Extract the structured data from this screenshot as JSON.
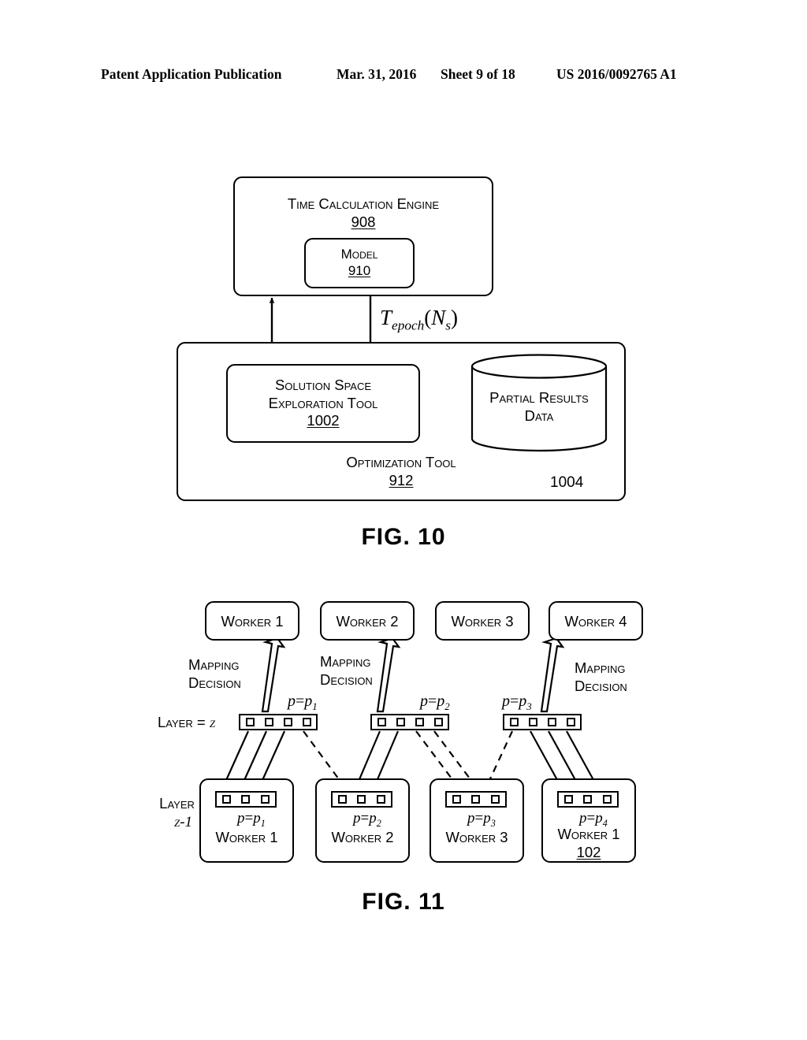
{
  "header": {
    "publication": "Patent Application Publication",
    "date": "Mar. 31, 2016",
    "sheet": "Sheet 9 of 18",
    "patent_number": "US 2016/0092765 A1"
  },
  "fig10": {
    "caption": "FIG. 10",
    "time_calculation_engine": {
      "label": "Time Calculation Engine",
      "ref": "908"
    },
    "model": {
      "label": "Model",
      "ref": "910"
    },
    "solution_space_exploration_tool": {
      "label_line1": "Solution Space",
      "label_line2": "Exploration Tool",
      "ref": "1002"
    },
    "partial_results_data": {
      "label_line1": "Partial Results",
      "label_line2": "Data",
      "ref": "1004"
    },
    "optimization_tool": {
      "label": "Optimization Tool",
      "ref": "912"
    },
    "epoch_arrow_label": {
      "base": "T",
      "sub": "epoch",
      "arg_open": "(",
      "arg": "N",
      "arg_sub": "s",
      "arg_close": ")"
    }
  },
  "fig11": {
    "caption": "FIG. 11",
    "top_workers": [
      {
        "label": "Worker 1",
        "has_mapping_arrow": true
      },
      {
        "label": "Worker 2",
        "has_mapping_arrow": true
      },
      {
        "label": "Worker 3",
        "has_mapping_arrow": false
      },
      {
        "label": "Worker 4",
        "has_mapping_arrow": true
      }
    ],
    "mapping_decision_labels": [
      {
        "line1": "Mapping",
        "line2": "Decision"
      },
      {
        "line1": "Mapping",
        "line2": "Decision"
      },
      {
        "line1": "Mapping",
        "line2": "Decision"
      }
    ],
    "layer_z_label": {
      "prefix": "Layer =",
      "value": "z"
    },
    "layer_z_minus_1_label": {
      "prefix": "Layer =",
      "value": "z-1"
    },
    "layer_z_groups": [
      {
        "p_label_base": "p",
        "p_label_eq": "=",
        "p_label_var": "p",
        "p_label_sub": "1",
        "cells": 4
      },
      {
        "p_label_base": "p",
        "p_label_eq": "=",
        "p_label_var": "p",
        "p_label_sub": "2",
        "cells": 4
      },
      {
        "p_label_base": "p",
        "p_label_eq": "=",
        "p_label_var": "p",
        "p_label_sub": "3",
        "cells": 4
      }
    ],
    "layer_z_minus_1_boxes": [
      {
        "worker_label": "Worker 1",
        "p_sub": "1",
        "cells": 3,
        "ref": ""
      },
      {
        "worker_label": "Worker 2",
        "p_sub": "2",
        "cells": 3,
        "ref": ""
      },
      {
        "worker_label": "Worker 3",
        "p_sub": "3",
        "cells": 3,
        "ref": ""
      },
      {
        "worker_label": "Worker 1",
        "p_sub": "4",
        "cells": 3,
        "ref": "102"
      }
    ]
  },
  "colors": {
    "ink": "#000000",
    "paper": "#ffffff"
  }
}
